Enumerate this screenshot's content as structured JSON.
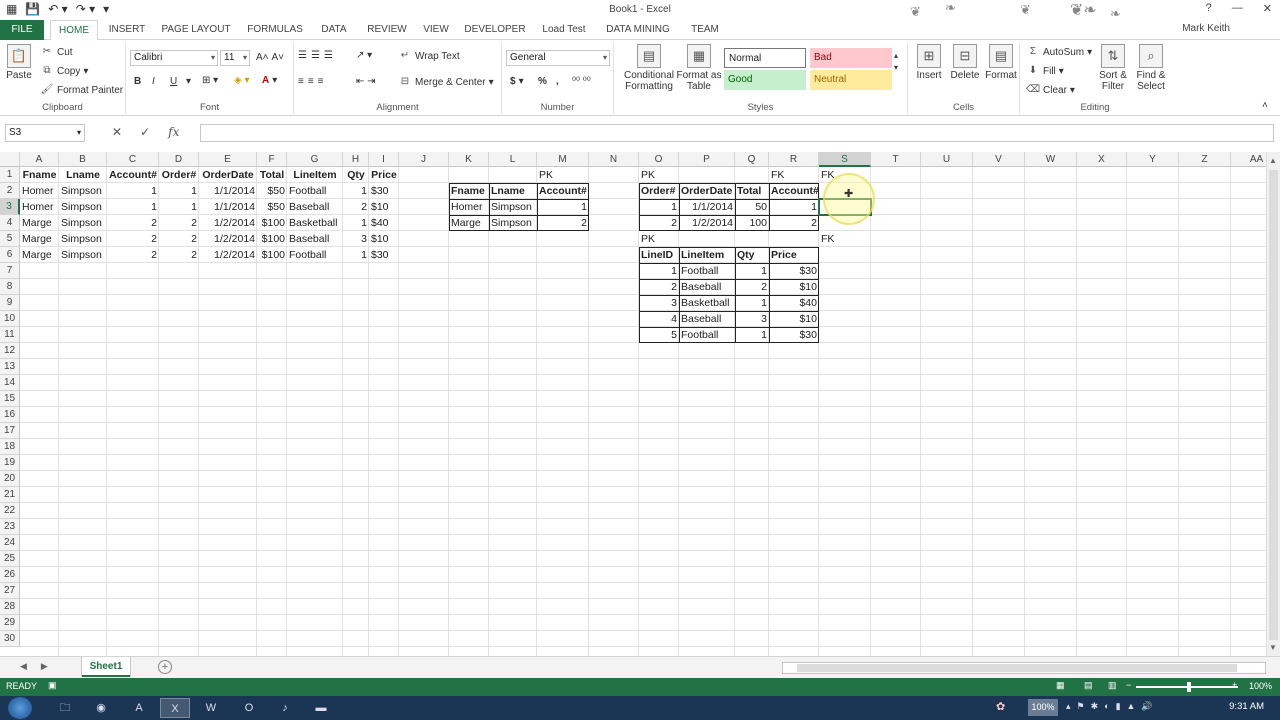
{
  "app": {
    "window_title": "Book1 - Excel",
    "user": "Mark Keith"
  },
  "ribbon_tabs": [
    "FILE",
    "HOME",
    "INSERT",
    "PAGE LAYOUT",
    "FORMULAS",
    "DATA",
    "REVIEW",
    "VIEW",
    "DEVELOPER",
    "Load Test",
    "DATA MINING",
    "TEAM"
  ],
  "active_tab": "HOME",
  "ribbon": {
    "clipboard": {
      "label": "Clipboard",
      "paste": "Paste",
      "cut": "Cut",
      "copy": "Copy",
      "format_painter": "Format Painter"
    },
    "font": {
      "label": "Font",
      "name": "Calibri",
      "size": "11",
      "bold": "B",
      "italic": "I",
      "underline": "U",
      "font_color_letter": "A"
    },
    "alignment": {
      "label": "Alignment",
      "wrap_text": "Wrap Text",
      "merge_center": "Merge & Center"
    },
    "number": {
      "label": "Number",
      "format": "General",
      "currency": "$",
      "percent": "%",
      "comma": ","
    },
    "styles": {
      "label": "Styles",
      "conditional_formatting": "Conditional Formatting",
      "format_as_table": "Format as Table",
      "normal": "Normal",
      "bad": "Bad",
      "good": "Good",
      "neutral": "Neutral"
    },
    "cells": {
      "label": "Cells",
      "insert": "Insert",
      "delete": "Delete",
      "format": "Format"
    },
    "editing": {
      "label": "Editing",
      "autosum": "AutoSum",
      "fill": "Fill",
      "clear": "Clear",
      "sort_filter": "Sort & Filter",
      "find_select": "Find & Select"
    }
  },
  "formula_bar": {
    "name_box": "S3",
    "fx": "fx",
    "value": ""
  },
  "columns": [
    "A",
    "B",
    "C",
    "D",
    "E",
    "F",
    "G",
    "H",
    "I",
    "J",
    "K",
    "L",
    "M",
    "N",
    "O",
    "P",
    "Q",
    "R",
    "S",
    "T",
    "U",
    "V",
    "W",
    "X",
    "Y",
    "Z",
    "AA"
  ],
  "selected_column": "S",
  "rows": [
    1,
    2,
    3,
    4,
    5,
    6,
    7,
    8,
    9,
    10,
    11,
    12,
    13,
    14,
    15,
    16,
    17,
    18,
    19,
    20,
    21,
    22,
    23,
    24,
    25,
    26,
    27,
    28,
    29,
    30
  ],
  "selected_row": 3,
  "sheet": {
    "flat_table": {
      "headers": [
        "Fname",
        "Lname",
        "Account#",
        "Order#",
        "OrderDate",
        "Total",
        "LineItem",
        "Qty",
        "Price"
      ],
      "rows": [
        [
          "Homer",
          "Simpson",
          "1",
          "1",
          "1/1/2014",
          "$50",
          "Football",
          "1",
          "$30"
        ],
        [
          "Homer",
          "Simpson",
          "1",
          "1",
          "1/1/2014",
          "$50",
          "Baseball",
          "2",
          "$10"
        ],
        [
          "Marge",
          "Simpson",
          "2",
          "2",
          "1/2/2014",
          "$100",
          "Basketball",
          "1",
          "$40"
        ],
        [
          "Marge",
          "Simpson",
          "2",
          "2",
          "1/2/2014",
          "$100",
          "Baseball",
          "3",
          "$10"
        ],
        [
          "Marge",
          "Simpson",
          "2",
          "2",
          "1/2/2014",
          "$100",
          "Football",
          "1",
          "$30"
        ]
      ]
    },
    "customers": {
      "pk_label": "PK",
      "headers": [
        "Fname",
        "Lname",
        "Account#"
      ],
      "rows": [
        [
          "Homer",
          "Simpson",
          "1"
        ],
        [
          "Marge",
          "Simpson",
          "2"
        ]
      ]
    },
    "orders": {
      "pk_label": "PK",
      "fk_label_r": "FK",
      "fk_label_s": "FK",
      "headers": [
        "Order#",
        "OrderDate",
        "Total",
        "Account#"
      ],
      "rows": [
        [
          "1",
          "1/1/2014",
          "50",
          "1"
        ],
        [
          "2",
          "1/2/2014",
          "100",
          "2"
        ]
      ]
    },
    "lineitems": {
      "pk_label": "PK",
      "fk_label": "FK",
      "headers": [
        "LineID",
        "LineItem",
        "Qty",
        "Price"
      ],
      "rows": [
        [
          "1",
          "Football",
          "1",
          "$30"
        ],
        [
          "2",
          "Baseball",
          "2",
          "$10"
        ],
        [
          "3",
          "Basketball",
          "1",
          "$40"
        ],
        [
          "4",
          "Baseball",
          "3",
          "$10"
        ],
        [
          "5",
          "Football",
          "1",
          "$30"
        ]
      ]
    }
  },
  "sheet_tabs": [
    "Sheet1"
  ],
  "status": {
    "mode": "READY",
    "zoom": "100%"
  },
  "taskbar": {
    "time": "9:31 AM",
    "volume_pct": "100%"
  },
  "colors": {
    "excel_green": "#217346",
    "bad_bg": "#ffc7ce",
    "good_bg": "#c6efce",
    "neutral_bg": "#ffeb9c"
  }
}
